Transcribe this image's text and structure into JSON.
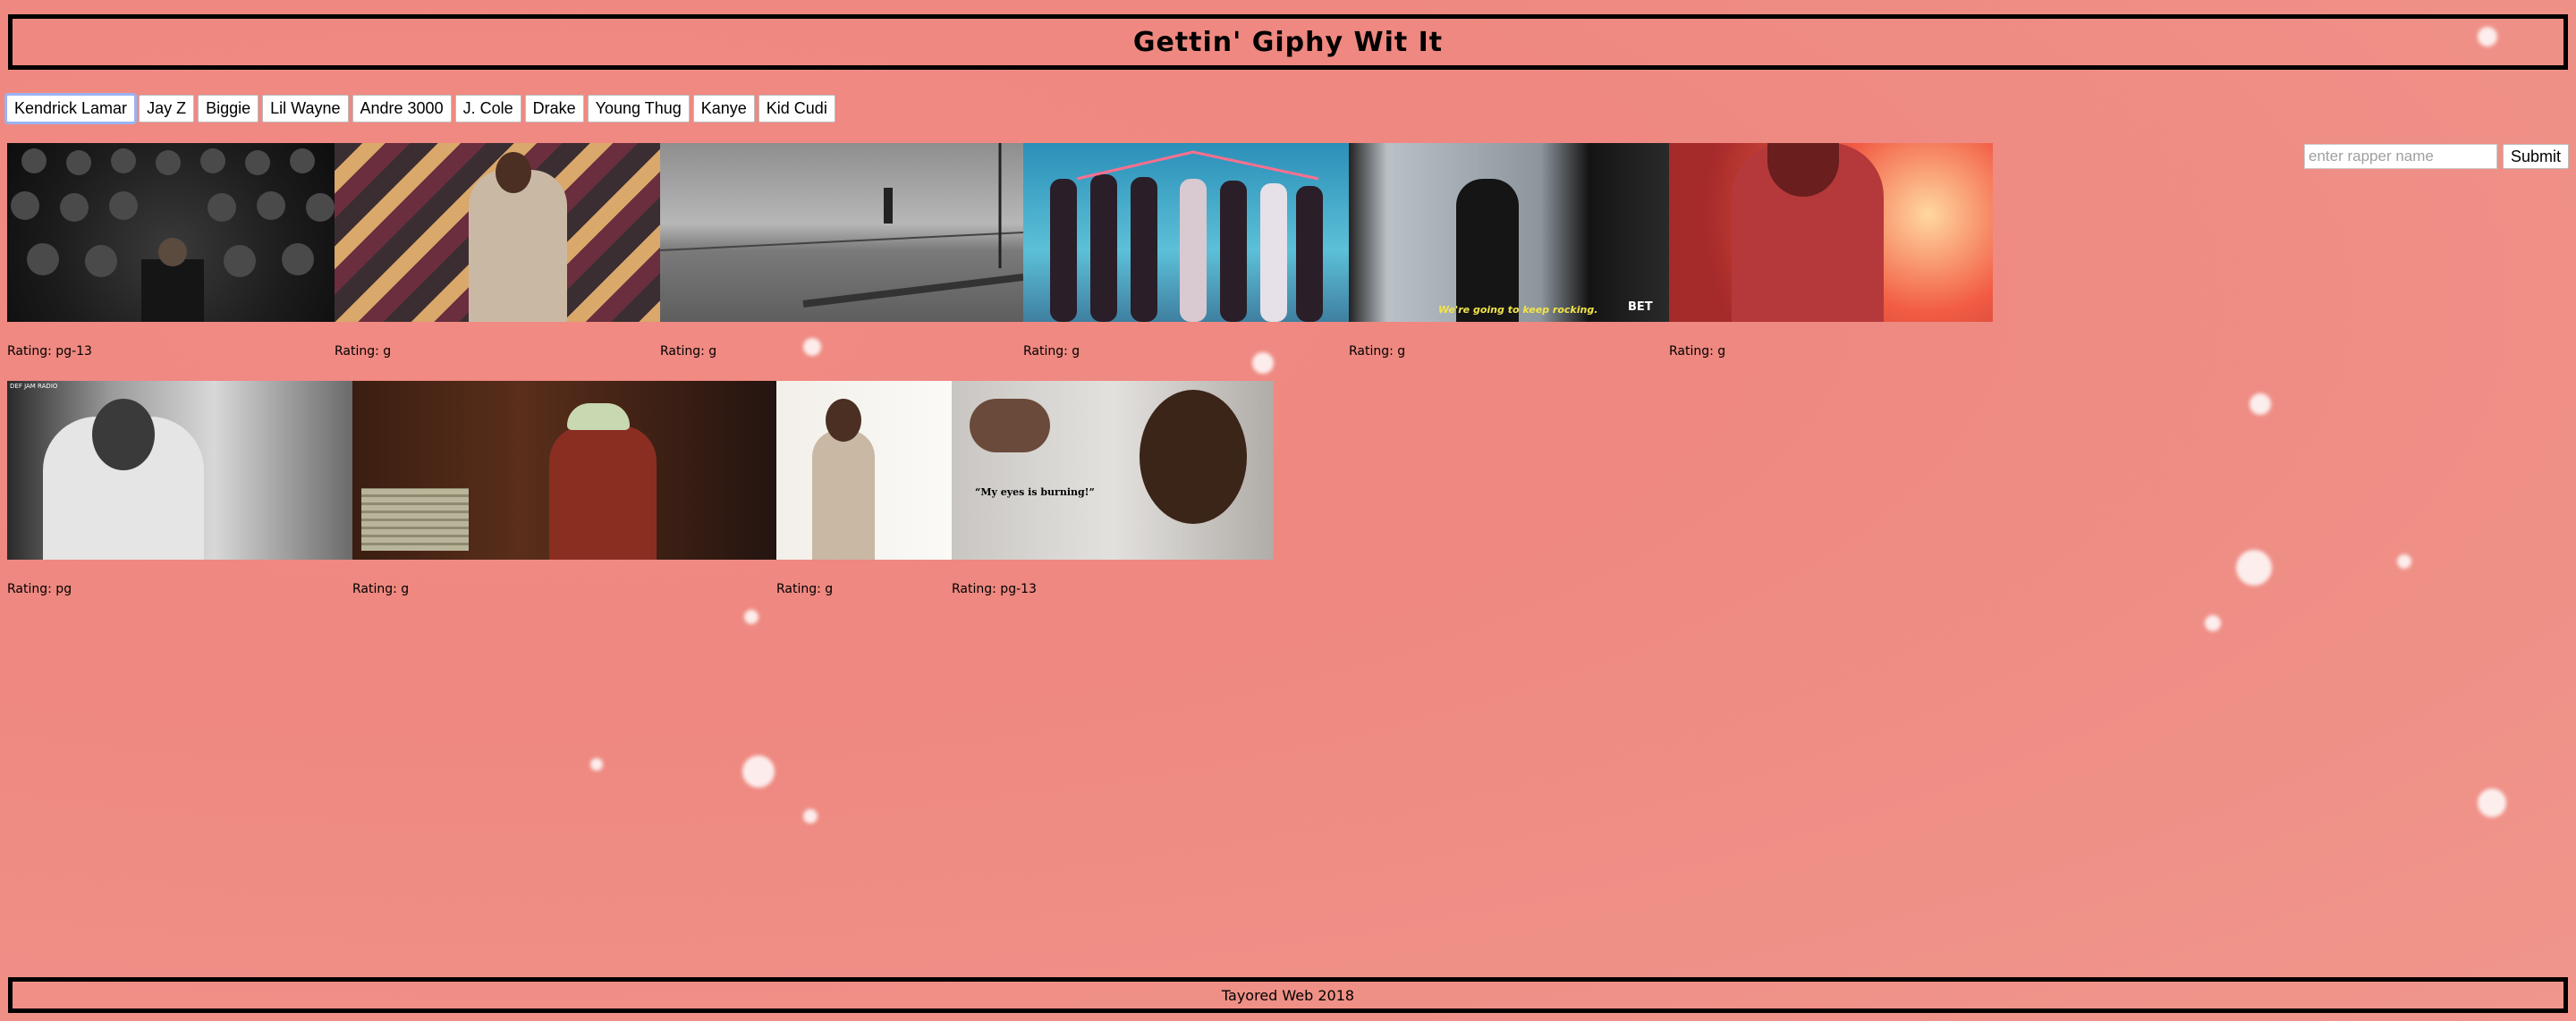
{
  "header": {
    "title": "Gettin' Giphy Wit It"
  },
  "rappers": [
    "Kendrick Lamar",
    "Jay Z",
    "Biggie",
    "Lil Wayne",
    "Andre 3000",
    "J. Cole",
    "Drake",
    "Young Thug",
    "Kanye",
    "Kid Cudi"
  ],
  "search": {
    "placeholder": "enter rapper name",
    "submit_label": "Submit"
  },
  "gifs": {
    "row1": [
      {
        "rating": "Rating: pg-13"
      },
      {
        "rating": "Rating: g"
      },
      {
        "rating": "Rating: g"
      },
      {
        "rating": "Rating: g"
      },
      {
        "rating": "Rating: g",
        "caption": "We're going to keep rocking.",
        "logo": "BET"
      },
      {
        "rating": "Rating: g"
      }
    ],
    "row2": [
      {
        "rating": "Rating: pg",
        "corner_text": "DEF JAM RADIO"
      },
      {
        "rating": "Rating: g"
      },
      {
        "rating": "Rating: g"
      },
      {
        "rating": "Rating: pg-13",
        "caption": "“My eyes is burning!”"
      }
    ]
  },
  "footer": {
    "text": "Tayored Web 2018"
  }
}
